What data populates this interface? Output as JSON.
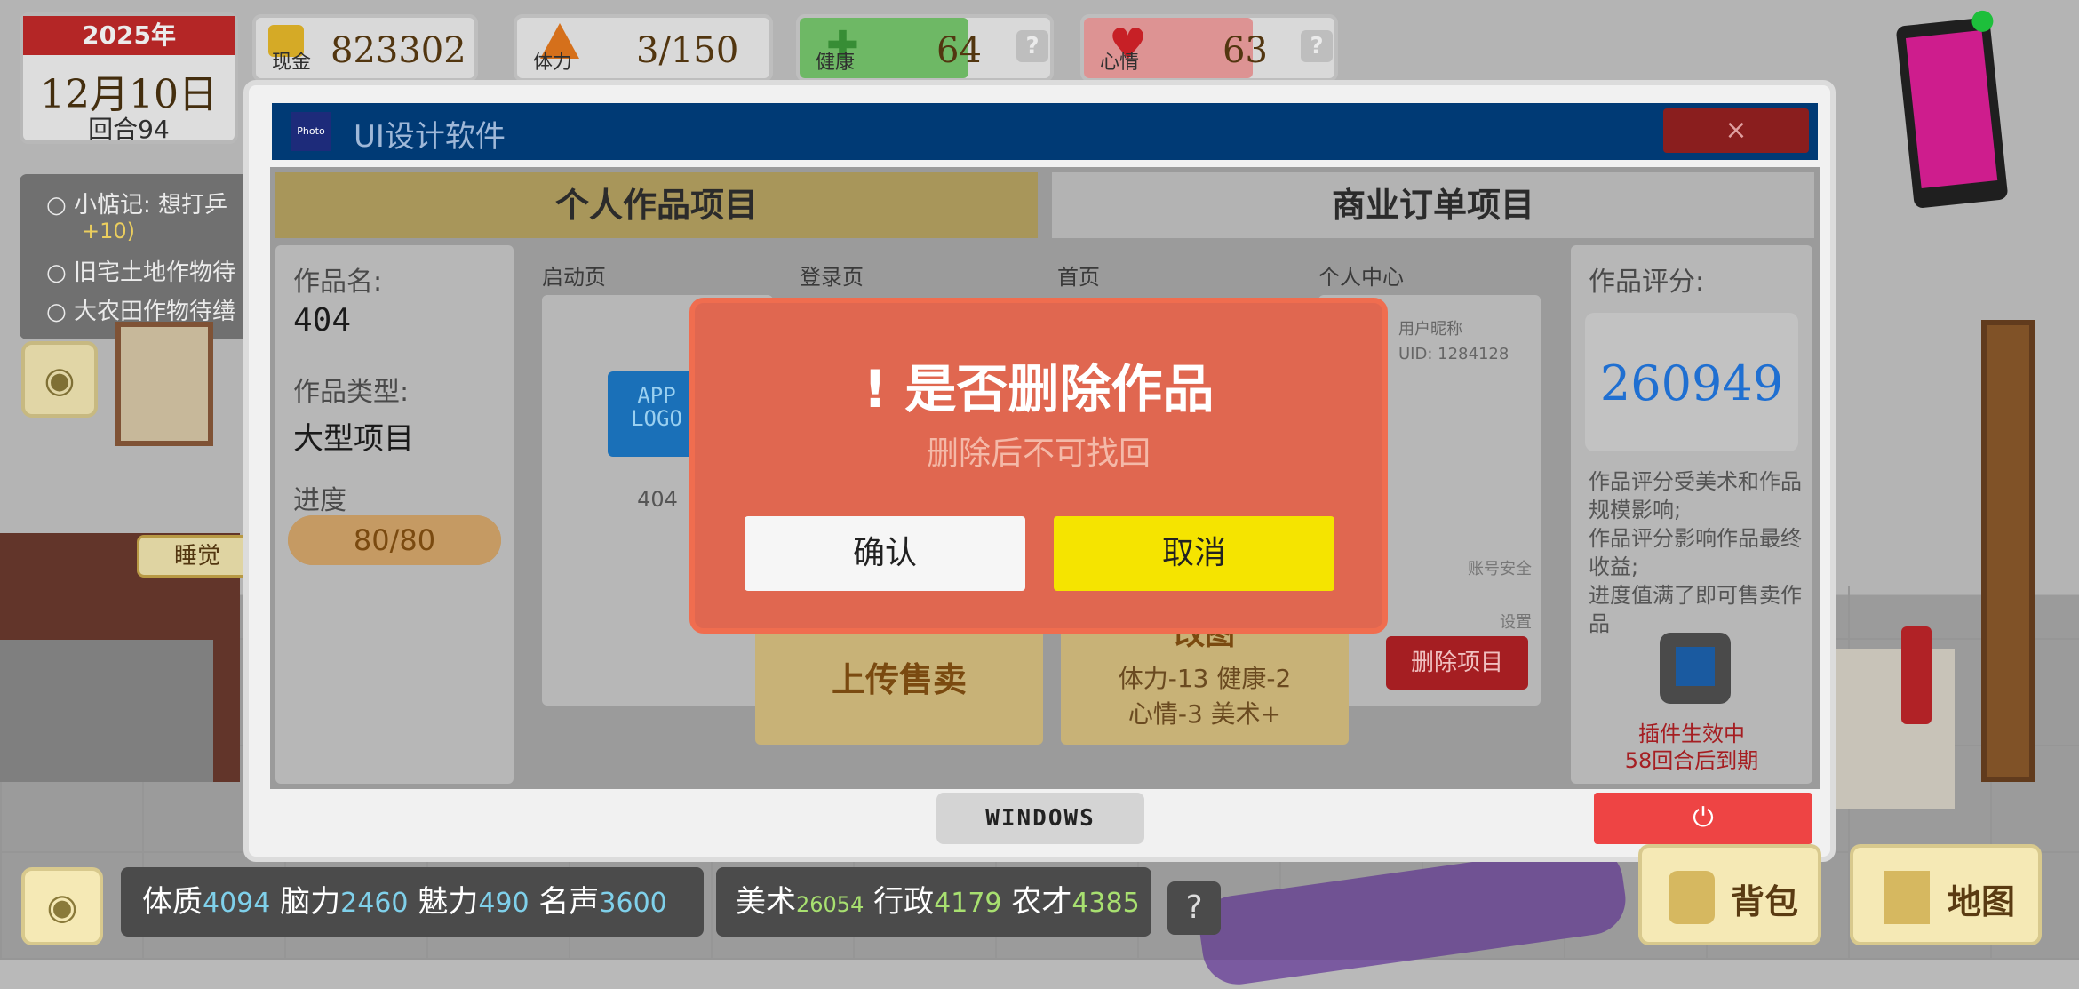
{
  "date": {
    "year": "2025年",
    "day": "12月10日",
    "round": "回合94"
  },
  "stats": {
    "cash": {
      "label": "现金",
      "value": "823302"
    },
    "stamina": {
      "label": "体力",
      "value": "3/150"
    },
    "health": {
      "label": "健康",
      "value": "64"
    },
    "mood": {
      "label": "心情",
      "value": "63"
    },
    "help": "?"
  },
  "tasks": [
    {
      "text": "小惦记: 想打乒",
      "extra": "+10)"
    },
    {
      "text": "旧宅土地作物待"
    },
    {
      "text": "大农田作物待缮"
    }
  ],
  "scene": {
    "sleep_label": "睡觉"
  },
  "window": {
    "app_icon": "Photo",
    "title": "UI设计软件",
    "close": "×",
    "tabs": [
      "个人作品项目",
      "商业订单项目"
    ],
    "work": {
      "name_label": "作品名:",
      "name": "404",
      "type_label": "作品类型:",
      "type": "大型项目",
      "progress_label": "进度",
      "progress": "80/80",
      "progress_fraction": 1.0
    },
    "pages": {
      "headers": [
        "启动页",
        "登录页",
        "首页",
        "个人中心"
      ],
      "logo_text": "APP LOGO",
      "logo_caption": "404",
      "user_nick": "用户昵称",
      "uid": "UID: 1284128",
      "account_security": "账号安全",
      "settings": "设置"
    },
    "actions": {
      "upload": "上传售卖",
      "redraw": "改图",
      "redraw_cost_1": "体力-13 健康-2",
      "redraw_cost_2": "心情-3 美术+",
      "delete": "删除项目"
    },
    "score": {
      "label": "作品评分:",
      "value": "260949",
      "desc": "作品评分受美术和作品规模影响;\n作品评分影响作品最终收益;\n进度值满了即可售卖作品",
      "plugin_1": "插件生效中",
      "plugin_2": "58回合后到期"
    },
    "footer": {
      "os_label": "WINDOWS",
      "power_icon": "power-icon"
    }
  },
  "modal": {
    "title": "! 是否删除作品",
    "subtitle": "删除后不可找回",
    "confirm": "确认",
    "cancel": "取消"
  },
  "attributes": {
    "group1": [
      {
        "name": "体质",
        "value": "4094"
      },
      {
        "name": "脑力",
        "value": "2460"
      },
      {
        "name": "魅力",
        "value": "490"
      },
      {
        "name": "名声",
        "value": "3600"
      }
    ],
    "group2": [
      {
        "name": "美术",
        "value": "26054"
      },
      {
        "name": "行政",
        "value": "4179"
      },
      {
        "name": "农才",
        "value": "4385"
      }
    ],
    "help": "?"
  },
  "buttons": {
    "bag": "背包",
    "map": "地图"
  },
  "colors": {
    "title_bar": "#003a75",
    "modal_bg": "#e06750",
    "cancel_button": "#f5e400",
    "score_text": "#1f6fd1",
    "delete_button": "#a51e22",
    "power_button": "#ee4444"
  }
}
